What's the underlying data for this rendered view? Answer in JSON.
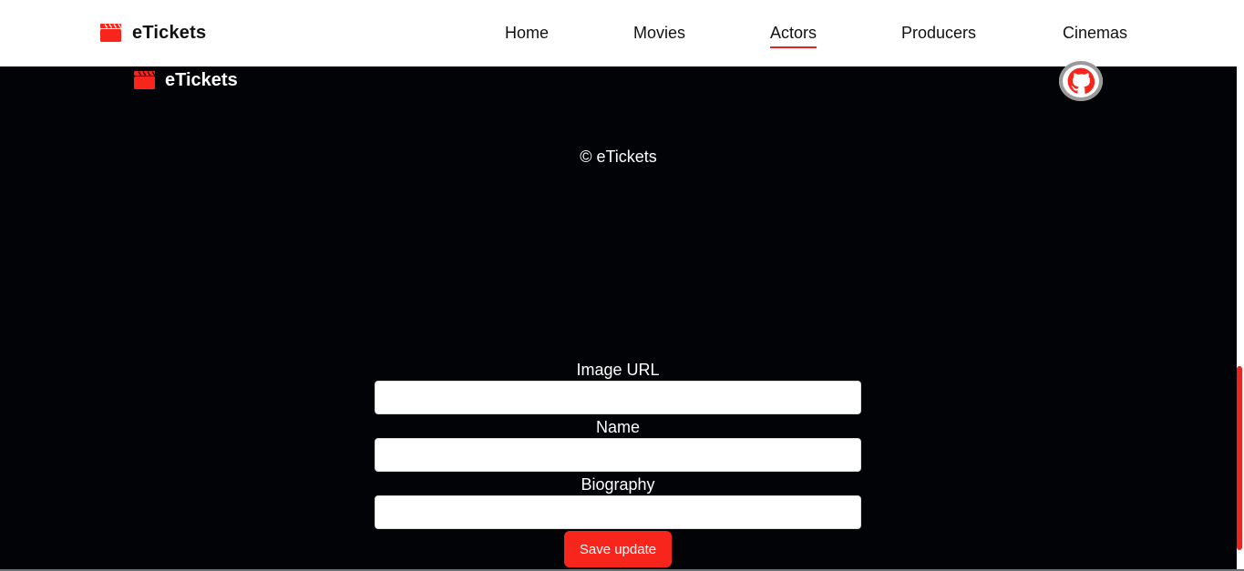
{
  "navbar": {
    "brand": "eTickets",
    "links": [
      {
        "label": "Home",
        "active": false
      },
      {
        "label": "Movies",
        "active": false
      },
      {
        "label": "Actors",
        "active": true
      },
      {
        "label": "Producers",
        "active": false
      },
      {
        "label": "Cinemas",
        "active": false
      }
    ]
  },
  "footer": {
    "brand": "eTickets",
    "github_icon": "github-icon",
    "copyright": "© eTickets"
  },
  "form": {
    "fields": [
      {
        "label": "Image URL",
        "value": "",
        "placeholder": ""
      },
      {
        "label": "Name",
        "value": "",
        "placeholder": ""
      },
      {
        "label": "Biography",
        "value": "",
        "placeholder": ""
      }
    ],
    "submit_label": "Save update"
  },
  "colors": {
    "accent": "#f7251b",
    "background": "#020306",
    "navbar": "#ffffff"
  }
}
